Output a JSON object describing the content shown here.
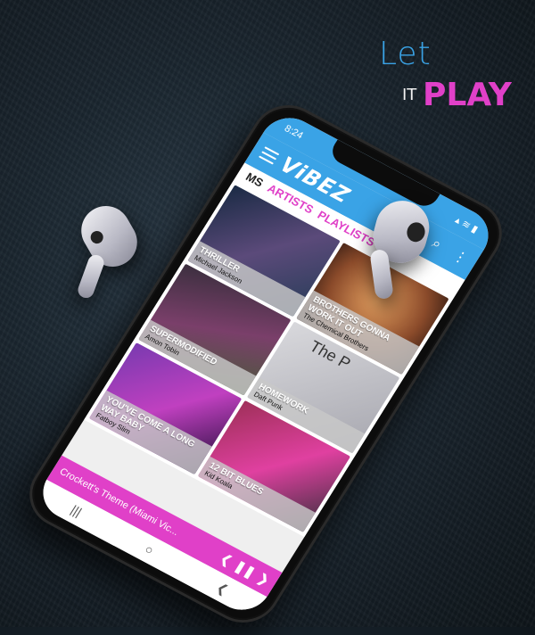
{
  "tagline": {
    "let": "Let",
    "it": "IT",
    "play": "PLAY"
  },
  "status": {
    "time": "8:24",
    "icons": "▴ ≋ ▮"
  },
  "header": {
    "logo": "ViBEZ",
    "search_icon": "⌕",
    "more_icon": "⋮",
    "menu_icon": "hamburger-menu-icon"
  },
  "tabs": [
    {
      "label": "MS"
    },
    {
      "label": "ARTISTS"
    },
    {
      "label": "PLAYLISTS"
    }
  ],
  "albums": [
    {
      "title": "THRILLER",
      "artist": "Michael Jackson"
    },
    {
      "title": "BROTHERS GONNA WORK IT OUT",
      "artist": "The Chemical Brothers"
    },
    {
      "title": "SUPERMODIFIED",
      "artist": "Amon Tobin"
    },
    {
      "title": "HOMEWORK",
      "artist": "Daft Punk"
    },
    {
      "title": "YOU'VE COME A LONG WAY BABY",
      "artist": "Fatboy Slim"
    },
    {
      "title": "12 BIT BLUES",
      "artist": "Kid Koala"
    }
  ],
  "album_art_text": "The P",
  "player": {
    "track": "Crockett's Theme (Miami Vic...",
    "prev": "❮",
    "pause": "❚❚",
    "next": "❯"
  },
  "navbar": {
    "recent": "|||",
    "home": "○",
    "back": "❮"
  },
  "colors": {
    "accent_blue": "#3aa3e6",
    "accent_pink": "#e040c8"
  }
}
